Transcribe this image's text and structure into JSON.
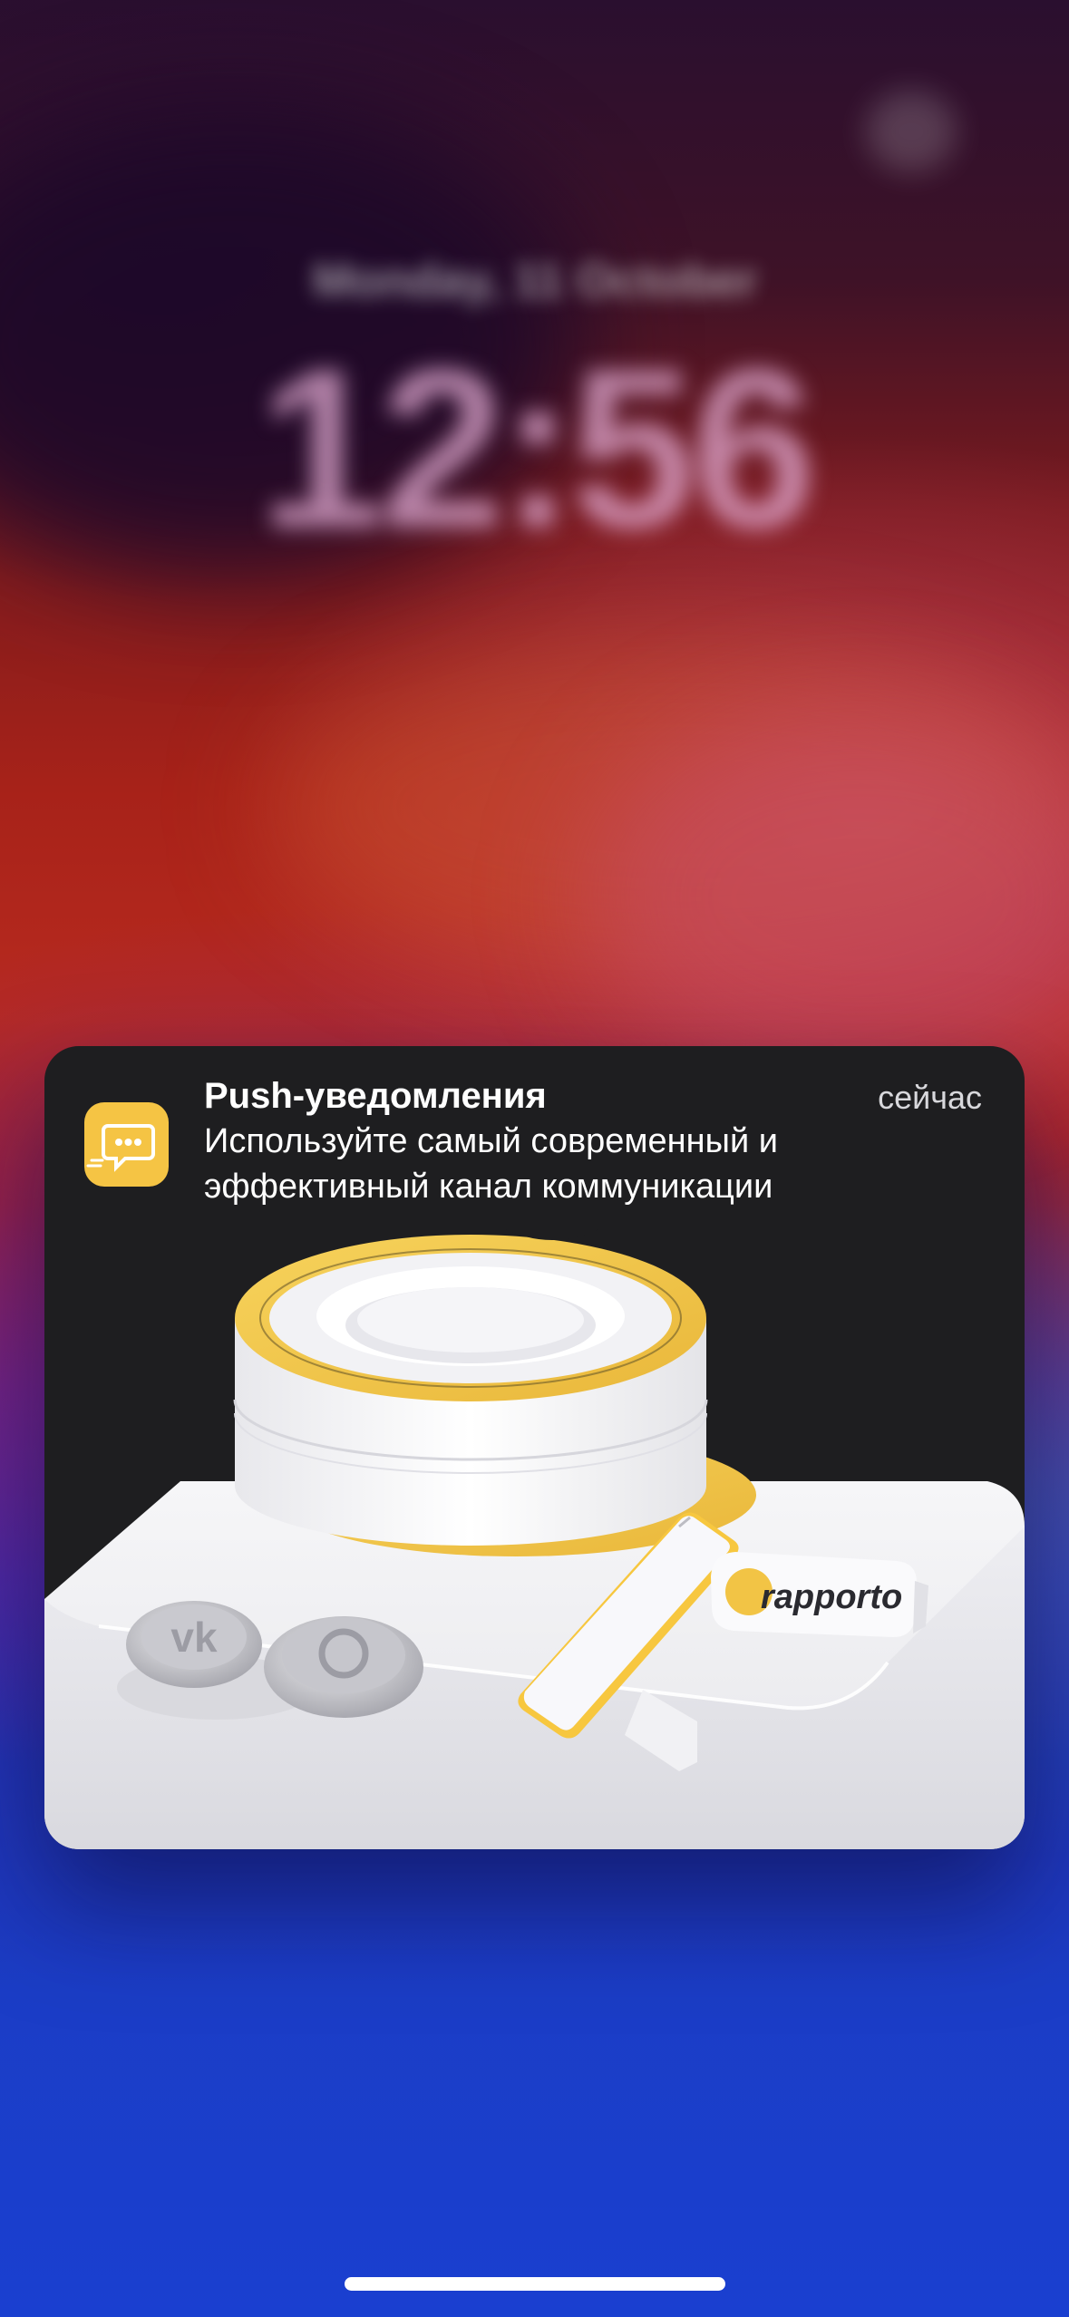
{
  "lock_screen": {
    "date_blurred": "Monday, 11 October",
    "time_blurred": "12:56"
  },
  "notification": {
    "app_icon": "chat-bubble-icon",
    "title": "Push-уведомления",
    "time": "сейчас",
    "body_line1": "Используйте самый современный и",
    "body_line2": "эффективный канал коммуникации",
    "image": {
      "brand_text": "rapporto",
      "icons": [
        "vk-coin-icon",
        "whatsapp-coin-icon",
        "smartphone-icon",
        "rapporto-logo"
      ]
    }
  },
  "colors": {
    "notification_bg": "#1e1e20",
    "accent_yellow": "#f5c444"
  }
}
